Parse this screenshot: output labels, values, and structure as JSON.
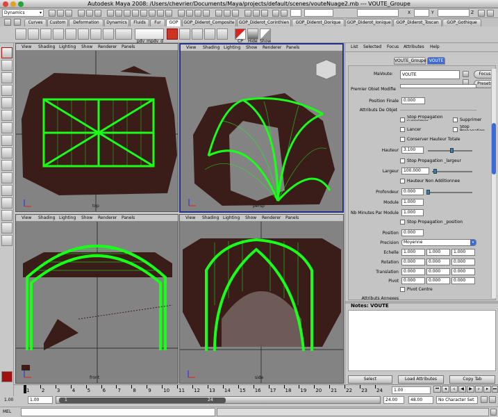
{
  "window": {
    "title": "Autodesk Maya 2008: /Users/chevrier/Documents/Maya/projects/default/scenes/vouteNuage2.mb   ---   VOUTE_Groupe"
  },
  "status": {
    "menu_set": "Dynamics",
    "coord_x_label": "X",
    "coord_y_label": "Y",
    "coord_z_label": "Z"
  },
  "shelf": {
    "tabs": [
      "Curves",
      "Custom",
      "Deformation",
      "Dynamics",
      "Fluids",
      "Fur",
      "GOP",
      "GOP_Diderot_Composite",
      "GOP_Diderot_Corinthien",
      "GOP_Diderot_Dorique",
      "GOP_Diderot_Ionique",
      "GOP_Diderot_Toscan",
      "GOP_Gothique"
    ],
    "active_tab": "GOP",
    "icon_labels": {
      "pdv": "pdv_mpdv_d",
      "cp": "CP",
      "hide": "Hide",
      "show": "Show"
    }
  },
  "viewport_menu": [
    "View",
    "Shading",
    "Lighting",
    "Show",
    "Renderer",
    "Panels"
  ],
  "viewports": {
    "top": "top",
    "persp": "persp",
    "front": "front",
    "side": "side"
  },
  "attr_editor": {
    "menu": [
      "List",
      "Selected",
      "Focus",
      "Attributes",
      "Help"
    ],
    "tabs": [
      "VOUTE_Groupe",
      "VOUTE"
    ],
    "node_label": "MaVoute:",
    "node_value": "VOUTE",
    "focus_btn": "Focus",
    "presets_btn": "Presets",
    "premier_objet": "Premier Objet Modifie",
    "position_finale_label": "Position Finale",
    "position_finale": "0.000",
    "attributs_label": "Attributs De Objet",
    "chk_stop_prop_supprimer": "Stop Propagation supprimer",
    "chk_supprimer": "Supprimer",
    "chk_lancer": "Lancer",
    "chk_stop_prop_objet": "Stop Propagation Objet",
    "chk_conserver": "Conserver Hauteur Totale",
    "hauteur_label": "Hauteur",
    "hauteur": "3.100",
    "chk_stop_largeur": "Stop Propagation _largeur",
    "largeur_label": "Largeur",
    "largeur": "100.000",
    "chk_hauteur_non": "Hauteur Non Additionnee",
    "profondeur_label": "Profondeur",
    "profondeur": "0.000",
    "module_label": "Module",
    "module": "1.000",
    "nb_minutes_label": "Nb Minutes Par Module",
    "nb_minutes": "1.000",
    "chk_stop_position": "Stop Propagation _position",
    "position_label": "Position",
    "position": "0.000",
    "precision_label": "Precision",
    "precision": "Moyenne",
    "echelle_label": "Echelle",
    "echelle": [
      "1.000",
      "1.000",
      "1.000"
    ],
    "rotation_label": "Rotation",
    "rotation": [
      "0.000",
      "0.000",
      "0.000"
    ],
    "translation_label": "Translation",
    "translation": [
      "0.000",
      "0.000",
      "0.000"
    ],
    "pivot_label": "Pivot",
    "pivot": [
      "0.000",
      "0.000",
      "0.000"
    ],
    "chk_pivot_centre": "Pivot Centre",
    "attributs_annexes": "Attributs Annexes",
    "notes_label": "Notes:  VOUTE",
    "btn_select": "Select",
    "btn_load": "Load Attributes",
    "btn_copy": "Copy Tab"
  },
  "timeline": {
    "ticks": [
      "1",
      "2",
      "3",
      "4",
      "5",
      "6",
      "7",
      "8",
      "9",
      "10",
      "11",
      "12",
      "13",
      "14",
      "15",
      "16",
      "17",
      "18",
      "19",
      "20",
      "21",
      "22",
      "23",
      "24"
    ],
    "current": "1.00"
  },
  "range": {
    "start": "1.00",
    "inner_start": "1.00",
    "range_start": "1",
    "range_end": "24",
    "inner_end": "24.00",
    "end": "48.00",
    "character_set": "No Character Set"
  },
  "command": {
    "label": "MEL"
  },
  "colors": {
    "curve": "#19ff19",
    "cloud": "#3a1c19",
    "viewport_bg": "#838383",
    "active_border": "#1f2f8a"
  }
}
